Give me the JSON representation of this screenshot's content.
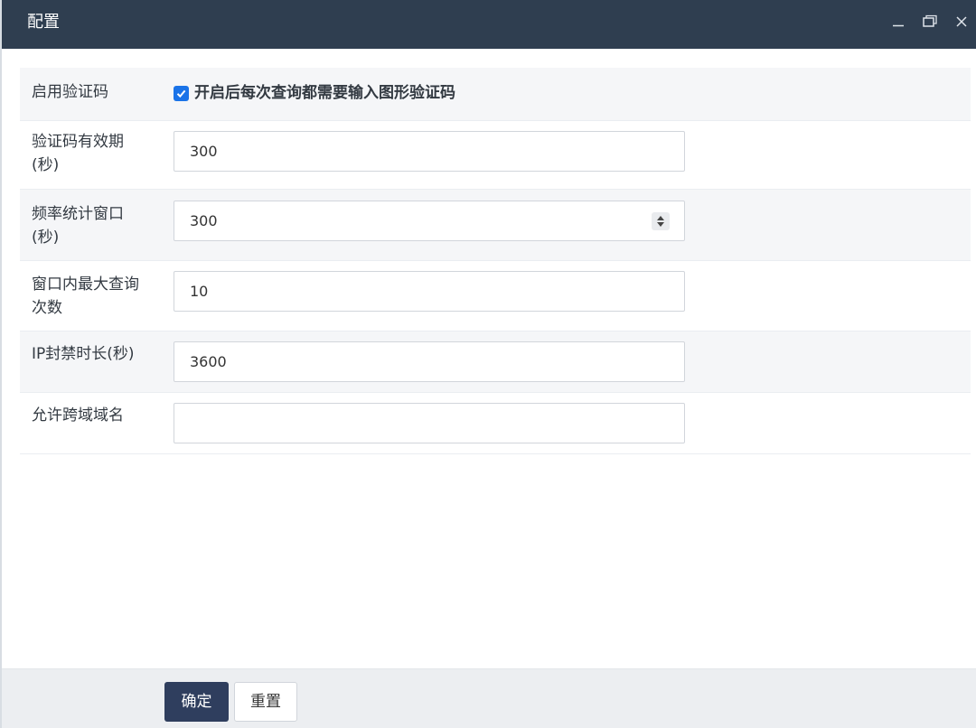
{
  "window": {
    "title": "配置"
  },
  "form": {
    "captcha_enable": {
      "label": "启用验证码",
      "checkbox_label": "开启后每次查询都需要输入图形验证码",
      "checked": true
    },
    "captcha_ttl": {
      "label": "验证码有效期\n(秒)",
      "value": "300"
    },
    "rate_window": {
      "label": "频率统计窗口\n(秒)",
      "value": "300"
    },
    "max_queries": {
      "label": "窗口内最大查询\n次数",
      "value": "10"
    },
    "ip_ban": {
      "label": "IP封禁时长(秒)",
      "value": "3600"
    },
    "cors_domains": {
      "label": "允许跨域域名",
      "value": ""
    }
  },
  "footer": {
    "confirm_label": "确定",
    "reset_label": "重置"
  },
  "colors": {
    "titlebar": "#2f3e50",
    "primary_button": "#2f3e5e",
    "checkbox": "#1a73e8"
  },
  "icons": {
    "minimize": "minimize-icon",
    "maximize": "maximize-icon",
    "close": "close-icon",
    "spin": "spin-arrows-icon",
    "check": "checkmark-icon"
  }
}
